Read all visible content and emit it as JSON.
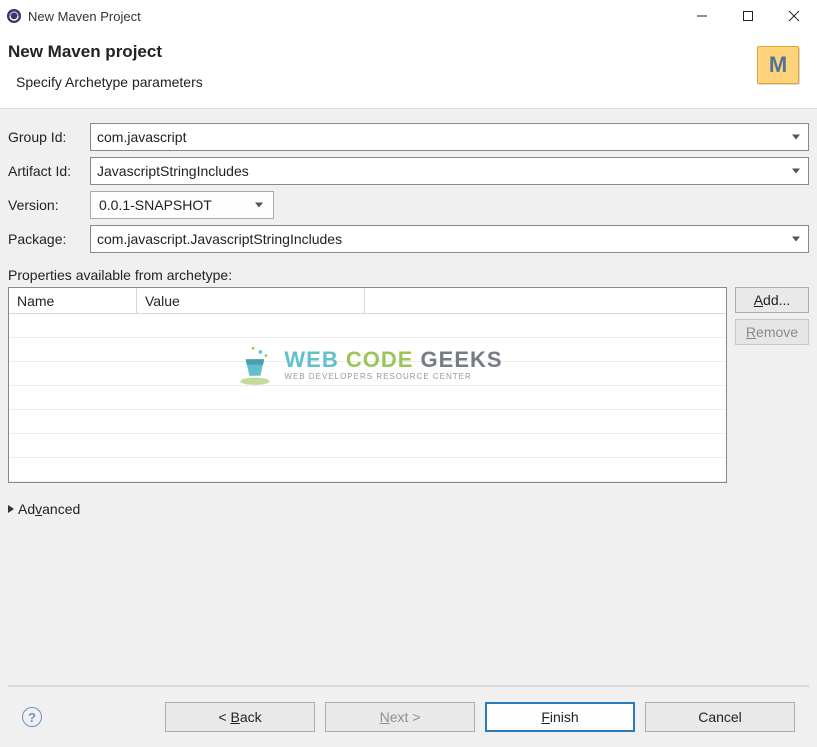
{
  "window": {
    "title": "New Maven Project"
  },
  "header": {
    "title": "New Maven project",
    "subtitle": "Specify Archetype parameters"
  },
  "form": {
    "groupId": {
      "label": "Group Id:",
      "value": "com.javascript"
    },
    "artifactId": {
      "label": "Artifact Id:",
      "value": "JavascriptStringIncludes"
    },
    "version": {
      "label": "Version:",
      "value": "0.0.1-SNAPSHOT"
    },
    "pkg": {
      "label": "Package:",
      "value": "com.javascript.JavascriptStringIncludes"
    }
  },
  "properties": {
    "label": "Properties available from archetype:",
    "columns": {
      "name": "Name",
      "value": "Value"
    },
    "buttons": {
      "add": "Add...",
      "remove": "Remove"
    }
  },
  "advanced": {
    "label": "Advanced"
  },
  "footer": {
    "back": "< Back",
    "next": "Next >",
    "finish": "Finish",
    "cancel": "Cancel"
  },
  "watermark": {
    "title_web": "WEB ",
    "title_code": "CODE ",
    "title_geeks": "GEEKS",
    "sub": "WEB DEVELOPERS RESOURCE CENTER"
  }
}
